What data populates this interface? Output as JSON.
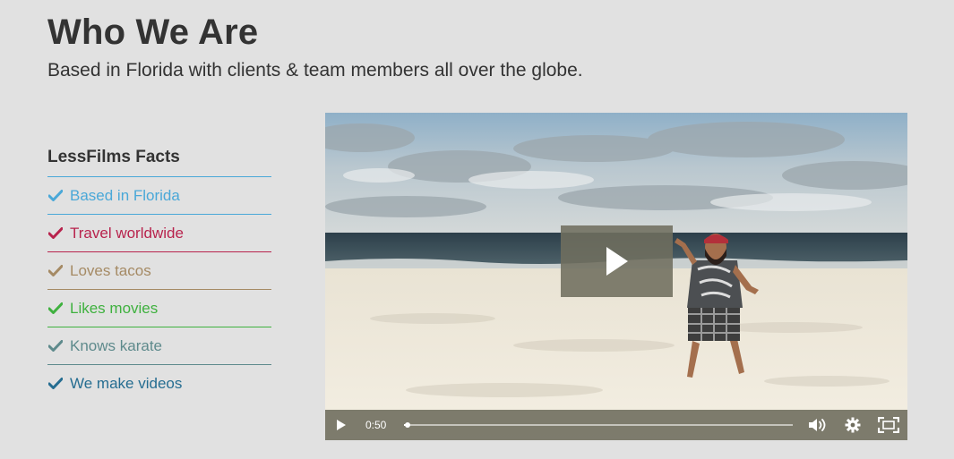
{
  "header": {
    "title": "Who We Are",
    "subtitle": "Based in Florida with clients & team members all over the globe."
  },
  "facts": {
    "heading": "LessFilms Facts",
    "items": [
      {
        "label": "Based in Florida",
        "color": "#4aa8d8",
        "icon": "check-icon"
      },
      {
        "label": "Travel worldwide",
        "color": "#b8234d",
        "icon": "check-icon"
      },
      {
        "label": "Loves tacos",
        "color": "#a58a64",
        "icon": "check-icon"
      },
      {
        "label": "Likes movies",
        "color": "#3fb13f",
        "icon": "check-icon"
      },
      {
        "label": "Knows karate",
        "color": "#5e8a8c",
        "icon": "check-icon"
      },
      {
        "label": "We make videos",
        "color": "#256d91",
        "icon": "check-icon"
      }
    ]
  },
  "video": {
    "time": "0:50",
    "progress": 0.01,
    "controls": {
      "play": "play-icon",
      "volume": "volume-icon",
      "settings": "gear-icon",
      "fullscreen": "fullscreen-icon"
    },
    "overlay_icon": "play-icon"
  }
}
